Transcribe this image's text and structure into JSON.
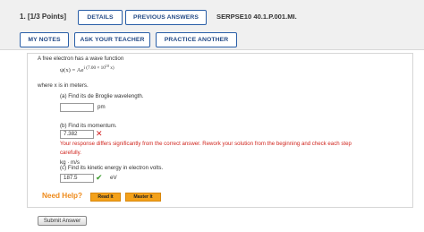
{
  "header": {
    "question_number": "1.",
    "points": "[1/3 Points]",
    "details_label": "DETAILS",
    "previous_answers_label": "PREVIOUS ANSWERS",
    "question_id": "SERPSE10 40.1.P.001.MI.",
    "my_notes_label": "MY NOTES",
    "ask_teacher_label": "ASK YOUR TEACHER",
    "practice_another_label": "PRACTICE ANOTHER"
  },
  "problem": {
    "intro": "A free electron has a wave function",
    "formula_left": "ψ(x) = Ae",
    "formula_exponent": "i (7.00 × 10",
    "formula_exponent_power": "10",
    "formula_exponent_tail": " x)",
    "where": "where x is in meters."
  },
  "parts": {
    "a": {
      "prompt": "(a) Find its de Broglie wavelength.",
      "value": "",
      "unit": "pm",
      "status": "empty"
    },
    "b": {
      "prompt": "(b) Find its momentum.",
      "value": "7.382",
      "unit": "kg · m/s",
      "status": "incorrect",
      "feedback_line1": "Your response differs significantly from the correct answer. Rework your solution from the beginning and check each step",
      "feedback_line2": "carefully."
    },
    "c": {
      "prompt": "(c) Find its kinetic energy in electron volts.",
      "value": "187.5",
      "unit": "eV",
      "status": "correct"
    }
  },
  "help": {
    "label": "Need Help?",
    "read_it": "Read It",
    "master_it": "Master It"
  },
  "submit_label": "Submit Answer",
  "colors": {
    "accent": "#2a5fa8",
    "error": "#d0251e",
    "correct": "#3a9b2c",
    "help": "#f3a11a"
  }
}
